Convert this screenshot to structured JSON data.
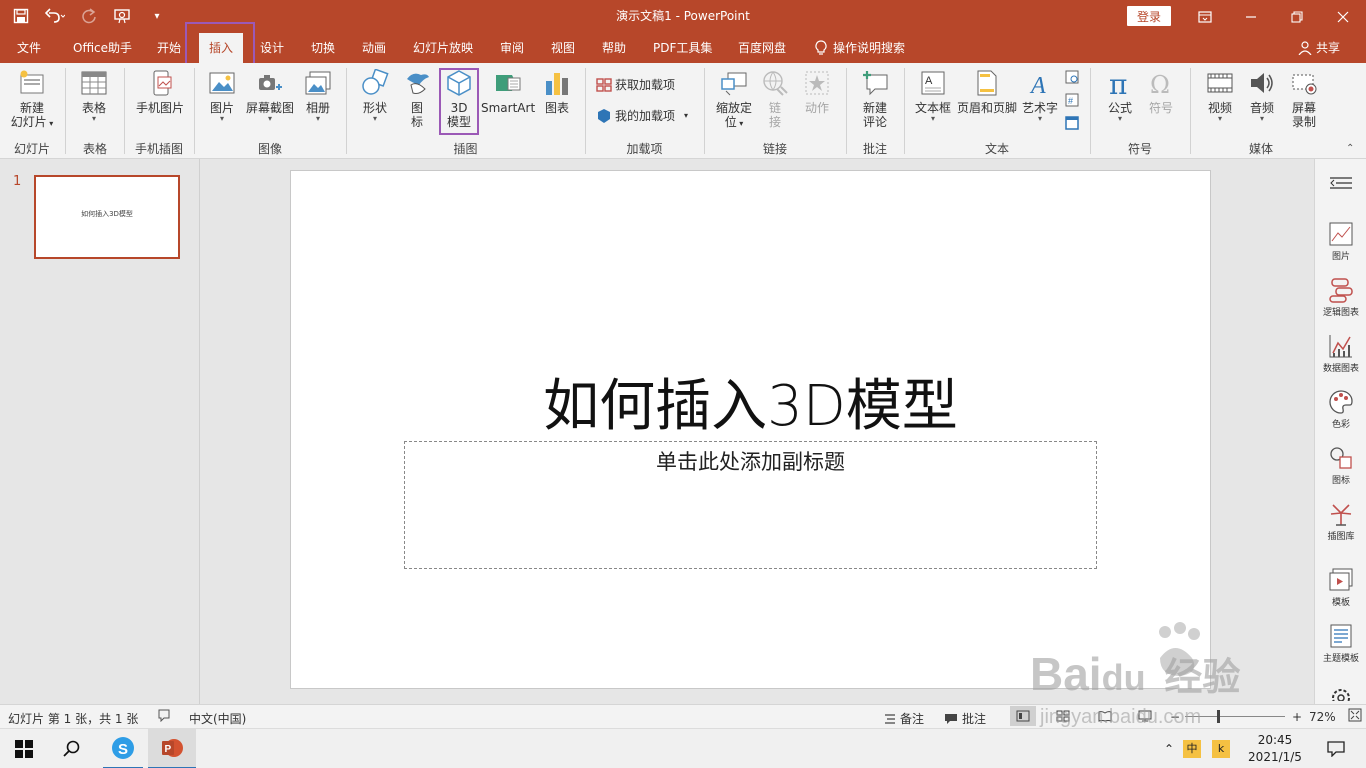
{
  "titlebar": {
    "doc_title": "演示文稿1  -  PowerPoint",
    "login": "登录",
    "qat_icons": [
      "save-icon",
      "undo-icon",
      "redo-icon",
      "presenter-icon",
      "customize-icon"
    ]
  },
  "tabs": [
    "文件",
    "Office助手",
    "开始",
    "插入",
    "设计",
    "切换",
    "动画",
    "幻灯片放映",
    "审阅",
    "视图",
    "帮助",
    "PDF工具集",
    "百度网盘",
    "操作说明搜索"
  ],
  "active_tab": "插入",
  "share": "共享",
  "ribbon": {
    "new_slide": [
      "新建",
      "幻灯片"
    ],
    "table": "表格",
    "phone_pic": "手机图片",
    "picture": "图片",
    "screenshot": "屏幕截图",
    "album": "相册",
    "shapes": "形状",
    "icons": [
      "图",
      "标"
    ],
    "model3d": [
      "3D",
      "模型"
    ],
    "smartart": "SmartArt",
    "chart": "图表",
    "get_addins": "获取加载项",
    "my_addins": "我的加载项",
    "zoom": [
      "缩放定",
      "位"
    ],
    "link": [
      "链",
      "接"
    ],
    "action": "动作",
    "new_comment": [
      "新建",
      "评论"
    ],
    "textbox": "文本框",
    "header_footer": "页眉和页脚",
    "wordart": "艺术字",
    "equation": "公式",
    "symbol": "符号",
    "video": "视频",
    "audio": "音频",
    "screen_record": [
      "屏幕",
      "录制"
    ],
    "groups": [
      "幻灯片",
      "表格",
      "手机插图",
      "图像",
      "插图",
      "加载项",
      "链接",
      "批注",
      "文本",
      "符号",
      "媒体"
    ]
  },
  "thumbnails": [
    {
      "number": "1",
      "title": "如何插入3D模型"
    }
  ],
  "slide": {
    "title": "如何插入3D模型",
    "subtitle_placeholder": "单击此处添加副标题"
  },
  "right_pane": [
    "图片",
    "逻辑图表",
    "数据图表",
    "色彩",
    "图标",
    "插图库",
    "模板",
    "主题模板"
  ],
  "status": {
    "slide_info": "幻灯片 第 1 张，共 1 张",
    "language": "中文(中国)",
    "notes": "备注",
    "comments": "批注",
    "zoom": "72%",
    "zoom_minus": "−",
    "zoom_plus": "+"
  },
  "taskbar": {
    "ime": "中",
    "time": "20:45",
    "date": "2021/1/5"
  },
  "watermark": {
    "brand": "Bai",
    "brand2": "du",
    "cn": "经验",
    "url": "jingyan.baidu.com"
  }
}
